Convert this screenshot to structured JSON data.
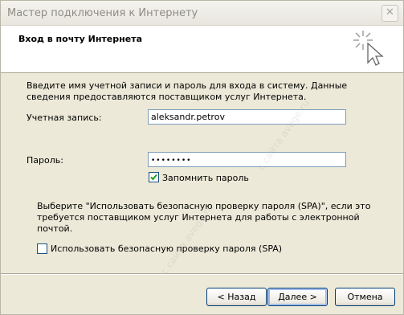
{
  "window": {
    "title": "Мастер подключения к Интернету",
    "close_glyph": "✕"
  },
  "header": {
    "title": "Вход в почту Интернета",
    "icon": "wizard-sparkle-cursor-icon"
  },
  "intro_text": "Введите имя учетной записи и пароль для входа в систему. Данные сведения предоставляются поставщиком услуг Интернета.",
  "account": {
    "label": "Учетная запись:",
    "value": "aleksandr.petrov"
  },
  "password": {
    "label": "Пароль:",
    "value": "••••••••"
  },
  "remember_password": {
    "label": "Запомнить пароль",
    "checked": true
  },
  "spa_text": "Выберите \"Использовать безопасную проверку пароля (SPA)\", если это требуется поставщиком услуг Интернета для работы с электронной почтой.",
  "spa_checkbox": {
    "label": "Использовать безопасную проверку пароля (SPA)",
    "checked": false
  },
  "buttons": {
    "back": "< Назад",
    "next": "Далее >",
    "cancel": "Отмена"
  },
  "watermark": "с сайта avege.ru",
  "colors": {
    "dialog_bg": "#ece9d8",
    "header_bg": "#ffffff",
    "input_border": "#7f9db9",
    "check_green": "#21a121"
  }
}
